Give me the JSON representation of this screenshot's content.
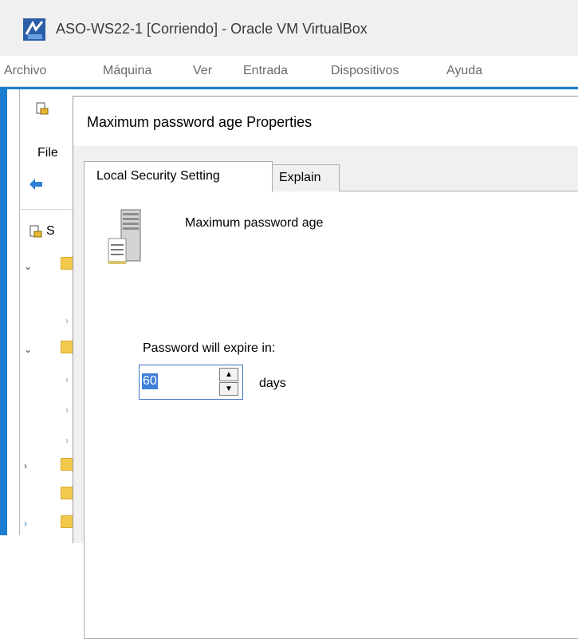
{
  "vbox": {
    "title": "ASO-WS22-1 [Corriendo] - Oracle VM VirtualBox",
    "menu": [
      "Archivo",
      "Máquina",
      "Ver",
      "Entrada",
      "Dispositivos",
      "Ayuda"
    ]
  },
  "mmc": {
    "file_menu": "File",
    "tree_root_partial": "S"
  },
  "dialog": {
    "title": "Maximum password age Properties",
    "tabs": [
      "Local Security Setting",
      "Explain"
    ],
    "setting_name": "Maximum password age",
    "expire_label": "Password will expire in:",
    "expire_value": "60",
    "unit": "days"
  },
  "icons": {
    "vbox_logo": "virtualbox-logo-icon",
    "policy": "policy-icon",
    "back": "back-arrow-icon",
    "setting": "server-document-icon",
    "spin_up": "spin-up-icon",
    "spin_down": "spin-down-icon"
  },
  "colors": {
    "guest_border": "#1a7fd1",
    "selection": "#3f7fd9",
    "dialog_bg": "#f0f0f0"
  }
}
